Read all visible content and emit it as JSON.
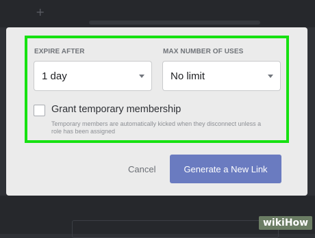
{
  "dialog": {
    "expire": {
      "label": "EXPIRE AFTER",
      "selected": "1 day"
    },
    "max_uses": {
      "label": "MAX NUMBER OF USES",
      "selected": "No limit"
    },
    "temporary": {
      "label": "Grant temporary membership",
      "checked": false,
      "hint": "Temporary members are automatically kicked when they disconnect unless a role has been assigned"
    },
    "cancel_label": "Cancel",
    "generate_label": "Generate a New Link"
  },
  "watermark": {
    "text": "wikiHow"
  },
  "colors": {
    "highlight": "#16e111",
    "primary_button": "#6a7bc0",
    "modal_bg": "#ebebeb",
    "backdrop": "#2f3136"
  },
  "icons": {
    "dropdown": "caret-down-icon",
    "checkbox": "checkbox-unchecked-icon"
  }
}
